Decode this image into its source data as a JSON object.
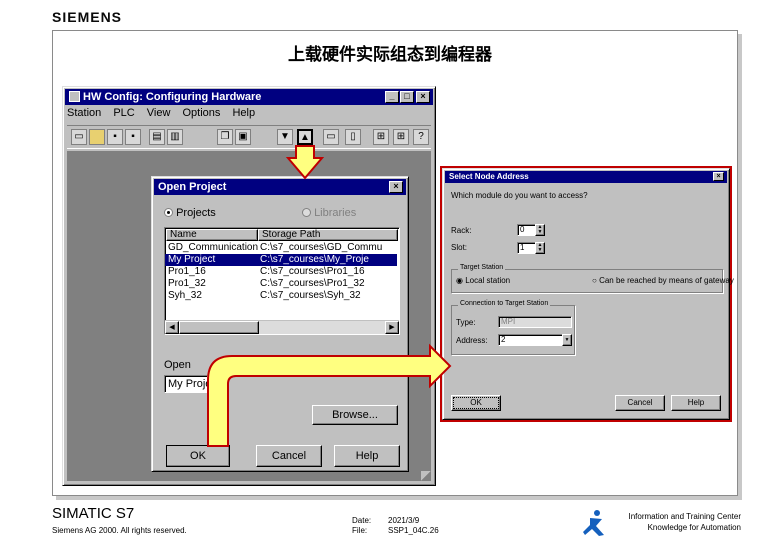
{
  "brand": {
    "logo": "SIEMENS"
  },
  "slide": {
    "title": "上载硬件实际组态到编程器"
  },
  "hw_window": {
    "title": "HW Config: Configuring Hardware",
    "menu": [
      "Station",
      "PLC",
      "View",
      "Options",
      "Help"
    ],
    "title_buttons": [
      "_",
      "□",
      "×"
    ]
  },
  "open_project": {
    "title": "Open Project",
    "radio_projects": "Projects",
    "radio_libraries": "Libraries",
    "columns": [
      "Name",
      "Storage Path"
    ],
    "rows": [
      {
        "name": "GD_Communication",
        "path": "C:\\s7_courses\\GD_Commu"
      },
      {
        "name": "My Project",
        "path": "C:\\s7_courses\\My_Proje"
      },
      {
        "name": "Pro1_16",
        "path": "C:\\s7_courses\\Pro1_16"
      },
      {
        "name": "Pro1_32",
        "path": "C:\\s7_courses\\Pro1_32"
      },
      {
        "name": "Syh_32",
        "path": "C:\\s7_courses\\Syh_32"
      }
    ],
    "open_label": "Open",
    "open_value": "My Project",
    "browse_label": "Browse...",
    "ok_label": "OK",
    "cancel_label": "Cancel",
    "help_label": "Help"
  },
  "select_node": {
    "title": "Select Node Address",
    "question": "Which module do you want to access?",
    "rack_label": "Rack:",
    "rack_value": "0",
    "slot_label": "Slot:",
    "slot_value": "1",
    "target_group": "Target Station",
    "local_station": "Local station",
    "gateway": "Can be reached by means of gateway",
    "connection_group": "Connection to Target Station",
    "type_label": "Type:",
    "type_value": "MPI",
    "address_label": "Address:",
    "address_value": "2",
    "ok_label": "OK",
    "cancel_label": "Cancel",
    "help_label": "Help"
  },
  "footer": {
    "product": "SIMATIC S7",
    "copyright": "Siemens AG 2000. All rights reserved.",
    "date_label": "Date:",
    "date_value": "2021/3/9",
    "file_label": "File:",
    "file_value": "SSP1_04C.26",
    "center_line1": "Information and Training Center",
    "center_line2": "Knowledge for Automation"
  },
  "colors": {
    "titlebar": "#000080",
    "arrow_fill": "#ffff80",
    "arrow_border": "#c00000"
  }
}
